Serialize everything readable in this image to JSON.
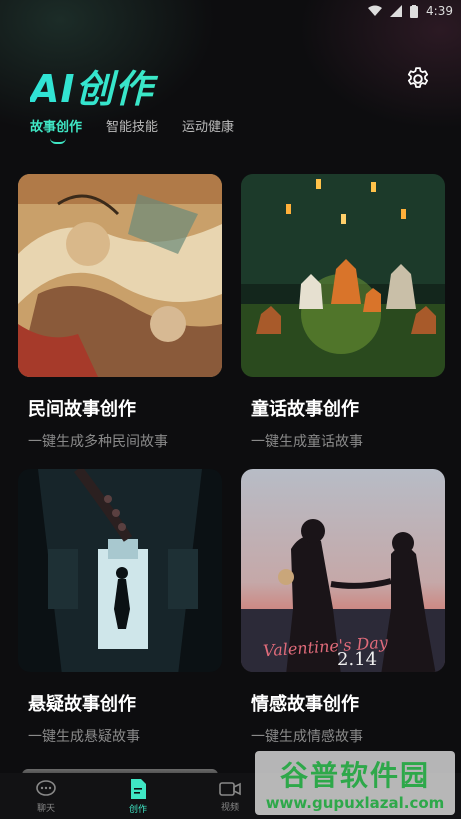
{
  "status_bar": {
    "time": "4:39"
  },
  "header": {
    "title": "AI创作"
  },
  "tabs": [
    {
      "label": "故事创作",
      "active": true
    },
    {
      "label": "智能技能",
      "active": false
    },
    {
      "label": "运动健康",
      "active": false
    }
  ],
  "cards": [
    {
      "name": "民间故事创作",
      "desc": "一键生成多种民间故事"
    },
    {
      "name": "童话故事创作",
      "desc": "一键生成童话故事"
    },
    {
      "name": "悬疑故事创作",
      "desc": "一键生成悬疑故事"
    },
    {
      "name": "情感故事创作",
      "desc": "一键生成情感故事",
      "image_text": "2.14",
      "image_script": "Valentine's Day"
    }
  ],
  "nav": [
    {
      "label": "聊天",
      "icon": "chat-icon",
      "active": false
    },
    {
      "label": "创作",
      "icon": "document-icon",
      "active": true
    },
    {
      "label": "视频",
      "icon": "video-icon",
      "active": false
    }
  ],
  "watermark": {
    "top": "谷普软件园",
    "bottom": "www.gupuxlazal.com"
  },
  "colors": {
    "accent": "#3fe6c4",
    "background": "#0d0d0f"
  }
}
